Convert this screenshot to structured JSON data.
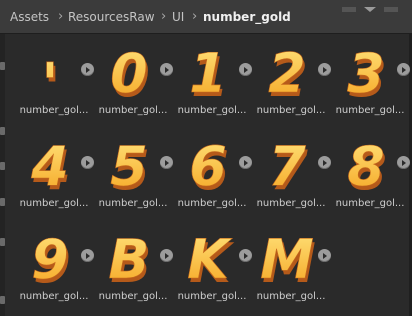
{
  "breadcrumb": {
    "items": [
      "Assets",
      "ResourcesRaw",
      "UI"
    ],
    "current": "number_gold",
    "separator": "›"
  },
  "assets": [
    {
      "glyph": "'",
      "label": "number_gol..."
    },
    {
      "glyph": "0",
      "label": "number_gol..."
    },
    {
      "glyph": "1",
      "label": "number_gol..."
    },
    {
      "glyph": "2",
      "label": "number_gol..."
    },
    {
      "glyph": "3",
      "label": "number_gol..."
    },
    {
      "glyph": "4",
      "label": "number_gol..."
    },
    {
      "glyph": "5",
      "label": "number_gol..."
    },
    {
      "glyph": "6",
      "label": "number_gol..."
    },
    {
      "glyph": "7",
      "label": "number_gol..."
    },
    {
      "glyph": "8",
      "label": "number_gol..."
    },
    {
      "glyph": "9",
      "label": "number_gol..."
    },
    {
      "glyph": "B",
      "label": "number_gol..."
    },
    {
      "glyph": "K",
      "label": "number_gol..."
    },
    {
      "glyph": "M",
      "label": "number_gol..."
    }
  ],
  "icons": {
    "play": "play-icon",
    "sprite": "gold-glyph-sprite"
  },
  "colors": {
    "gold_top": "#ffe27a",
    "gold_bottom": "#f5a623",
    "gold_shadow": "#b55a1a"
  }
}
